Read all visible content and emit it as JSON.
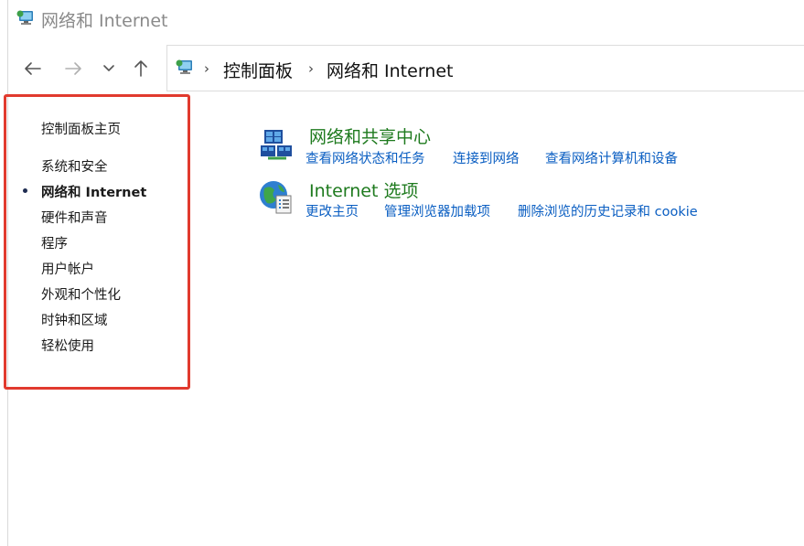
{
  "window": {
    "title": "网络和 Internet"
  },
  "nav": {
    "back": "back-arrow",
    "forward": "forward-arrow",
    "recent": "chevron-down",
    "up": "up-arrow"
  },
  "address": {
    "crumbs": [
      "控制面板",
      "网络和 Internet"
    ],
    "separator": "›"
  },
  "sidebar": {
    "items": [
      {
        "label": "控制面板主页"
      },
      {
        "label": "系统和安全"
      },
      {
        "label": "网络和 Internet",
        "active": true
      },
      {
        "label": "硬件和声音"
      },
      {
        "label": "程序"
      },
      {
        "label": "用户帐户"
      },
      {
        "label": "外观和个性化"
      },
      {
        "label": "时钟和区域"
      },
      {
        "label": "轻松使用"
      }
    ]
  },
  "main": {
    "sections": [
      {
        "title": "网络和共享中心",
        "links": [
          "查看网络状态和任务",
          "连接到网络",
          "查看网络计算机和设备"
        ]
      },
      {
        "title": "Internet 选项",
        "links": [
          "更改主页",
          "管理浏览器加载项",
          "删除浏览的历史记录和 cookie"
        ]
      }
    ]
  },
  "colors": {
    "section_title": "#1e7a1e",
    "link": "#0a5ec2",
    "highlight_border": "#e13a2e"
  }
}
